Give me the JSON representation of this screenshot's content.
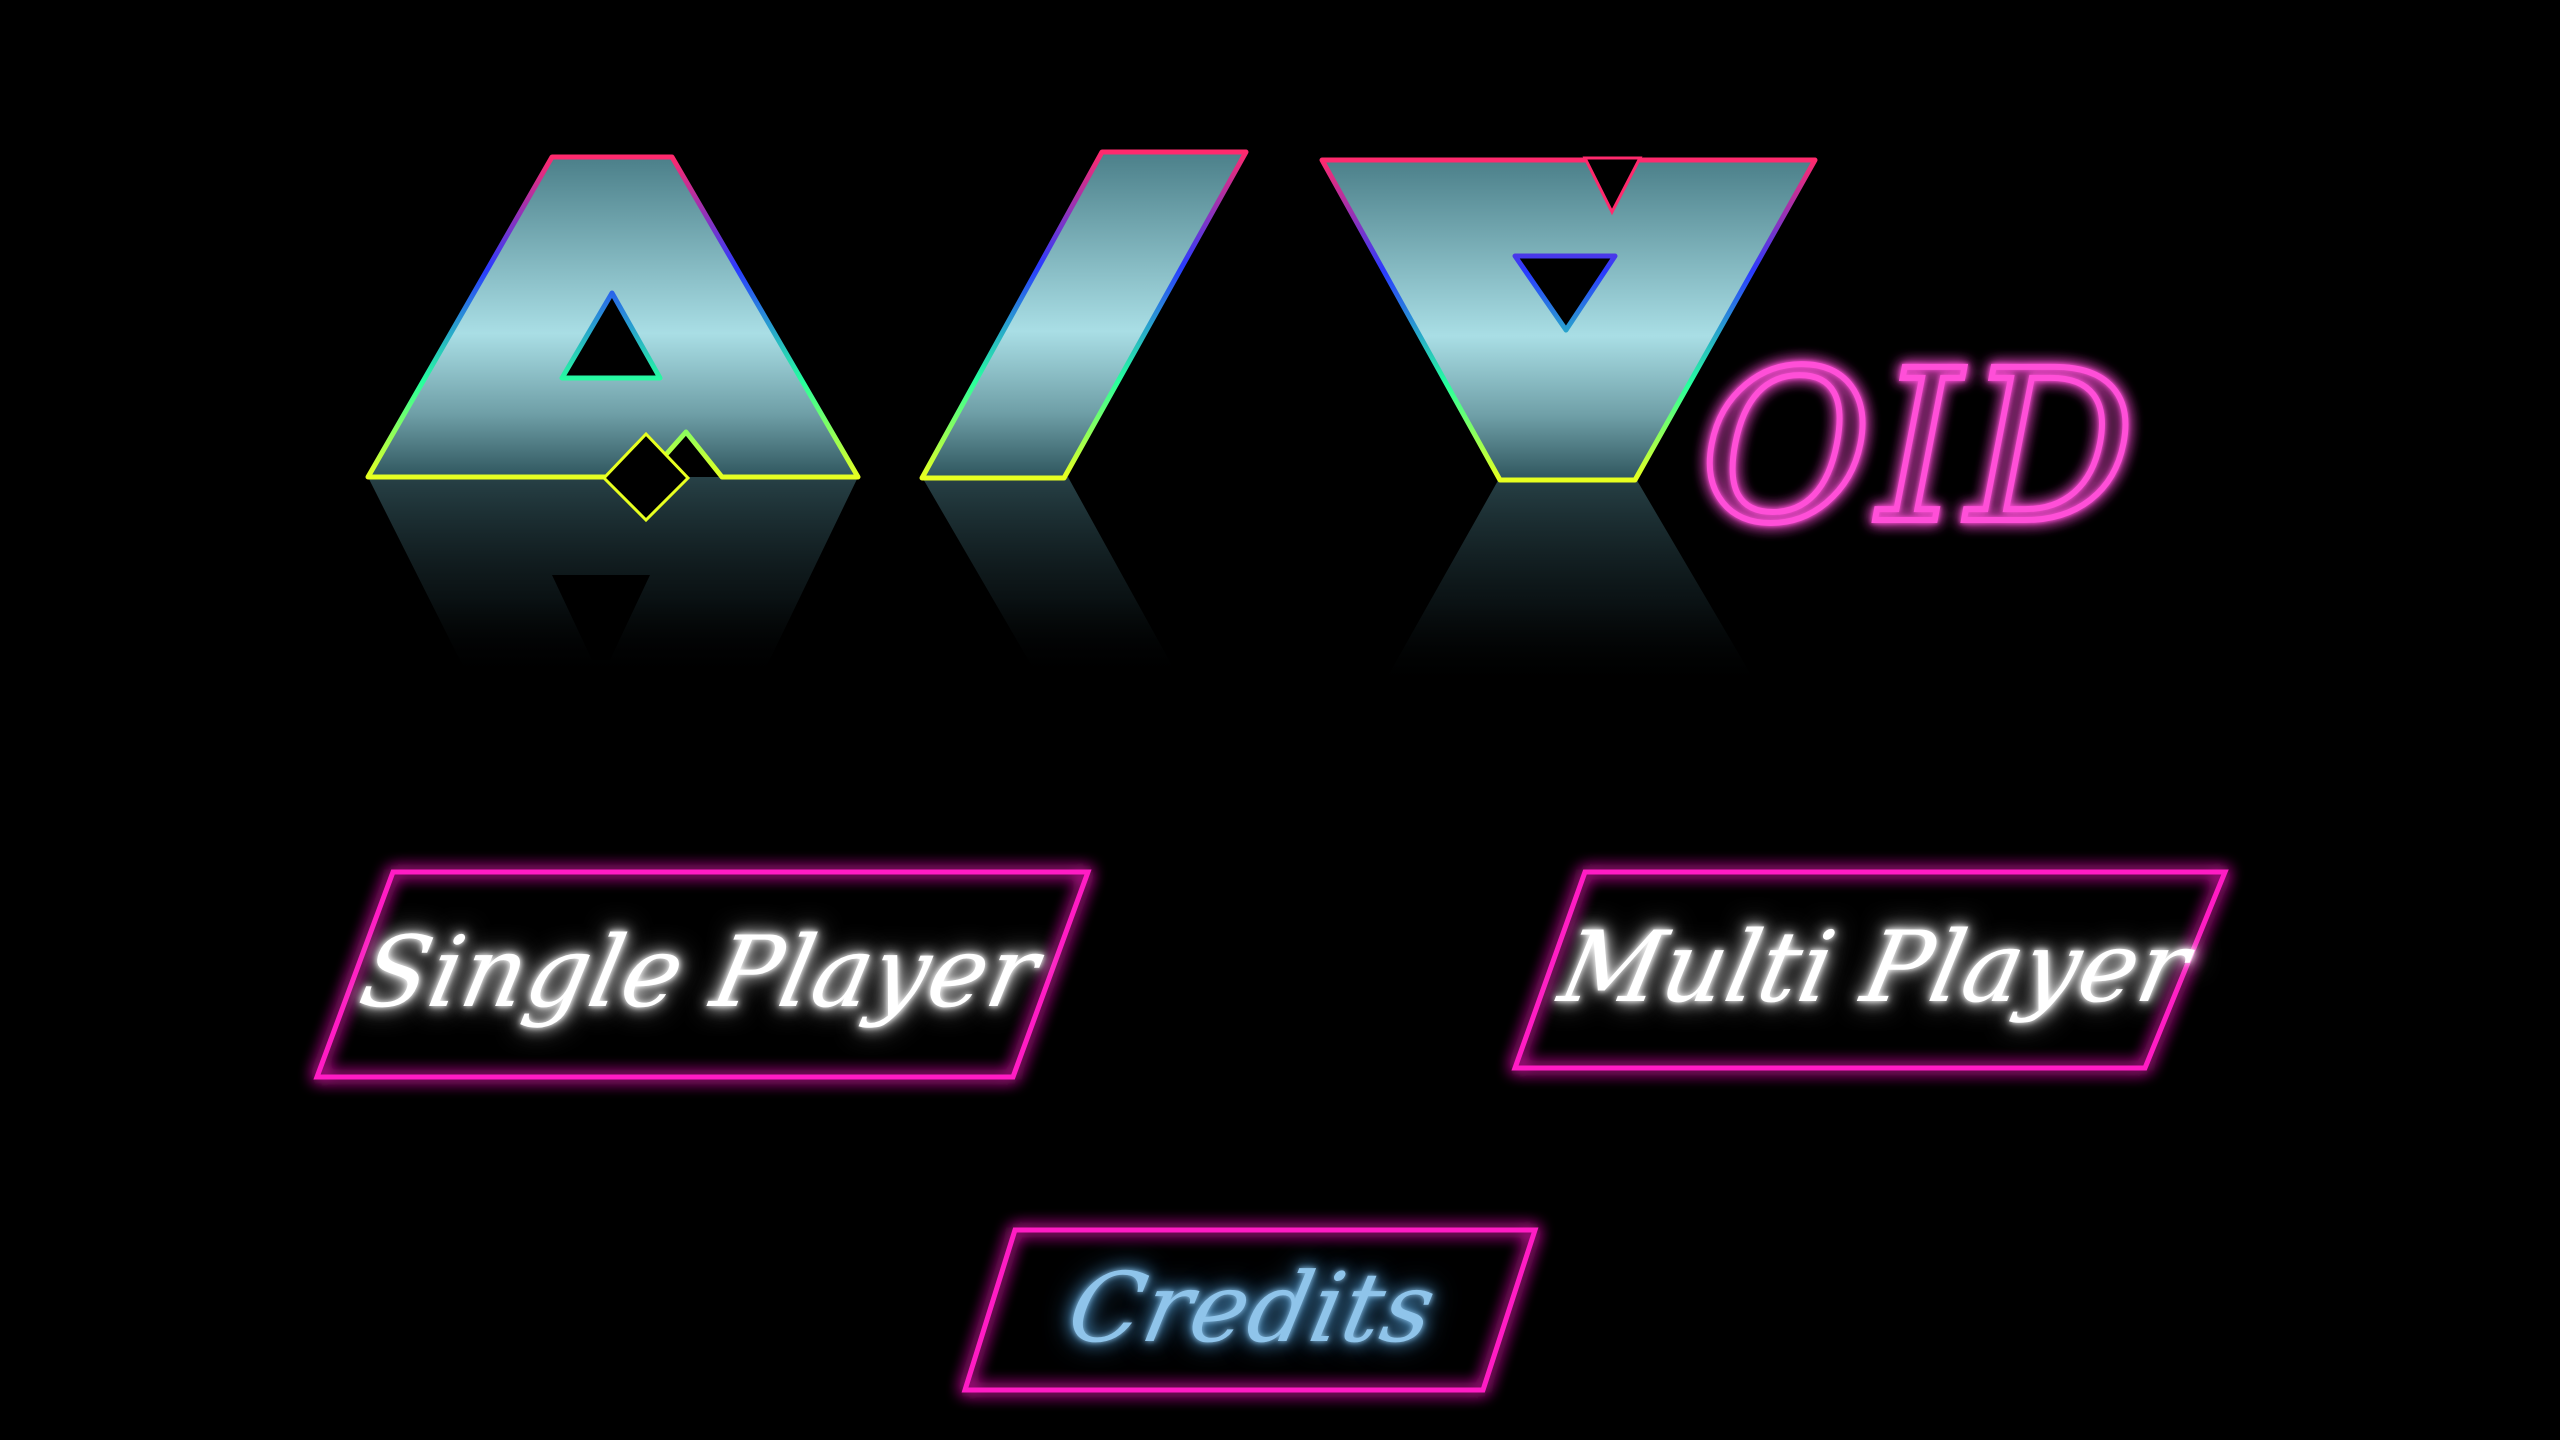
{
  "logo": {
    "suffix": "OID",
    "metal_gradient": [
      "#4b7f89",
      "#a9dee5",
      "#6f9fa7",
      "#2e555d"
    ],
    "edge_colors": [
      "#ff2a6d",
      "#2a3bff",
      "#27ff9f",
      "#e8ff20"
    ],
    "suffix_color": "#ff4fd8"
  },
  "menu": {
    "single_player": "Single Player",
    "multi_player": "Multi Player",
    "credits": "Credits"
  },
  "colors": {
    "background": "#000000",
    "button_frame": "#ff1fc4",
    "button_glow": "#ff00b4",
    "label_white": "#ffffff",
    "label_blue": "#8fc4ea"
  }
}
